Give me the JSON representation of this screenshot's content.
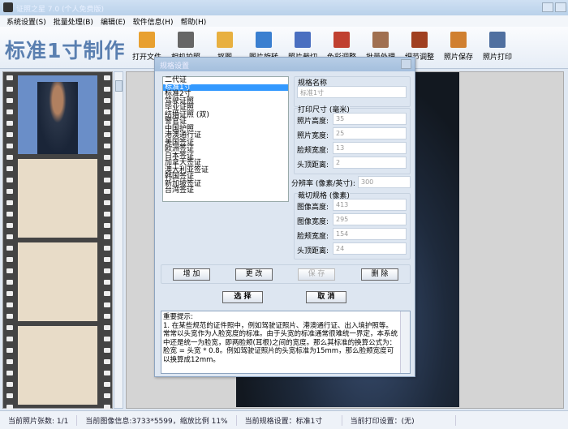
{
  "window": {
    "title": "证照之星 7.0 (个人免费版)"
  },
  "menu": [
    "系统设置(S)",
    "批量处理(B)",
    "编辑(E)",
    "软件信息(H)",
    "帮助(H)"
  ],
  "brand": "标准1寸制作",
  "toolbar": [
    {
      "label": "打开文件",
      "color": "#e8a030"
    },
    {
      "label": "相机拍照",
      "color": "#666"
    },
    {
      "label": "抠图",
      "color": "#e8b040"
    },
    {
      "label": "图片旋转",
      "color": "#3a7fd0"
    },
    {
      "label": "照片裁切",
      "color": "#4a6fc0"
    },
    {
      "label": "色彩调整",
      "color": "#c04030"
    },
    {
      "label": "批量处理",
      "color": "#a07050"
    },
    {
      "label": "细节调整",
      "color": "#a04020"
    },
    {
      "label": "照片保存",
      "color": "#d08030"
    },
    {
      "label": "照片打印",
      "color": "#5070a0"
    }
  ],
  "dialog": {
    "title": "规格设置",
    "specs": [
      "二代证",
      "标准1寸",
      "标准2寸",
      "驾驶证照",
      "毕业证照",
      "结婚证照 (双)",
      "警官证",
      "中国护照",
      "港澳通行证",
      "美国签证",
      "欧洲签证",
      "日本签证",
      "加拿大签证",
      "澳大利亚签证",
      "韩国签证",
      "新加坡签证",
      "台湾签证"
    ],
    "selected_index": 1,
    "name_label": "规格名称",
    "name_value": "标准1寸",
    "print_label": "打印尺寸 (毫米)",
    "print_fields": [
      {
        "label": "照片高度:",
        "value": "35"
      },
      {
        "label": "照片宽度:",
        "value": "25"
      },
      {
        "label": "脸颊宽度:",
        "value": "13"
      },
      {
        "label": "头顶距离:",
        "value": "2"
      }
    ],
    "dpi_label": "分辨率 (像素/英寸):",
    "dpi_value": "300",
    "crop_label": "裁切规格 (像素)",
    "crop_fields": [
      {
        "label": "图像高度:",
        "value": "413"
      },
      {
        "label": "图像宽度:",
        "value": "295"
      },
      {
        "label": "脸颊宽度:",
        "value": "154"
      },
      {
        "label": "头顶距离:",
        "value": "24"
      }
    ],
    "buttons": {
      "add": "增 加",
      "change": "更 改",
      "save": "保 存",
      "delete": "删 除",
      "select": "选 择",
      "cancel": "取 消"
    },
    "note_title": "重要提示:",
    "note": "1. 在某些规范的证件照中，例如驾驶证照片、港澳通行证、出入境护照等。常常以头宽作为人脸宽度的标准。由于头宽的标准通常很难统一界定，本系统中还是统一为脸宽，即两脸颊(耳根)之间的宽度。那么其标准的换算公式为：脸宽 = 头宽 * 0.8。例如驾驶证照片的头宽标准为15mm，那么脸颊宽度可以换算成12mm。"
  },
  "status": [
    "当前照片张数: 1/1",
    "当前图像信息:3733*5599，缩放比例 11%",
    "当前规格设置：标准1寸",
    "当前打印设置：(无)"
  ]
}
